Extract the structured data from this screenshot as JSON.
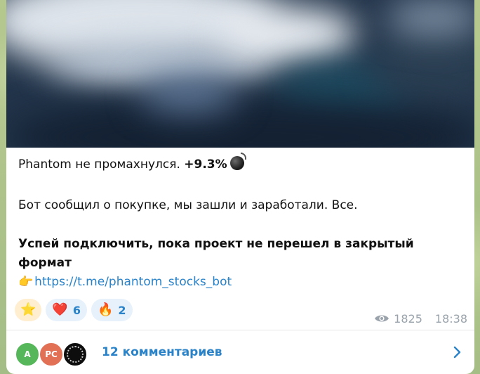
{
  "post": {
    "line1_text": "Phantom не промахнулся. ",
    "line1_bold": "+9.3%",
    "line1_emoji": "bomb-emoji",
    "line2": "Бот сообщил о покупке, мы зашли и заработали. Все.",
    "line3": "Успей подключить, пока проект не перешел в закрытый",
    "line4": "формат",
    "pointer_emoji": "👉",
    "link": "https://t.me/phantom_stocks_bot"
  },
  "reactions": [
    {
      "emoji": "⭐",
      "count": ""
    },
    {
      "emoji": "❤️",
      "count": "6"
    },
    {
      "emoji": "🔥",
      "count": "2"
    }
  ],
  "meta": {
    "views": "1825",
    "time": "18:38"
  },
  "comments": {
    "avatar1": "A",
    "avatar2": "PC",
    "label": "12 комментариев"
  },
  "colors": {
    "accent": "#2a83c8",
    "reaction_bg": "#e6f1fb",
    "star_bg": "#ffeed0",
    "meta": "#9aa3ab"
  }
}
